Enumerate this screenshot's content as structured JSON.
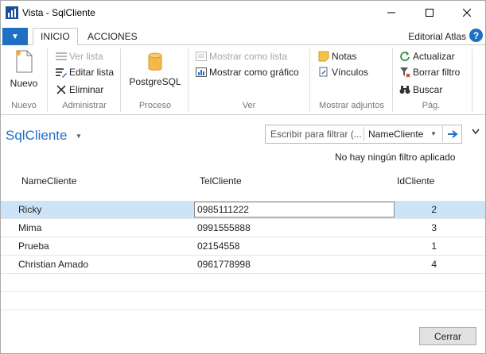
{
  "window": {
    "title": "Vista - SqlCliente"
  },
  "tabs": {
    "inicio": "INICIO",
    "acciones": "ACCIONES"
  },
  "company": "Editorial Atlas",
  "help_label": "?",
  "ribbon": {
    "nuevo": {
      "button": "Nuevo",
      "group": "Nuevo"
    },
    "administrar": {
      "ver_lista": "Ver lista",
      "editar_lista": "Editar lista",
      "eliminar": "Eliminar",
      "group": "Administrar"
    },
    "proceso": {
      "postgresql": "PostgreSQL",
      "group": "Proceso"
    },
    "ver": {
      "mostrar_lista": "Mostrar como lista",
      "mostrar_grafico": "Mostrar como gráfico",
      "group": "Ver"
    },
    "adjuntos": {
      "notas": "Notas",
      "vinculos": "Vínculos",
      "group": "Mostrar adjuntos"
    },
    "pag": {
      "actualizar": "Actualizar",
      "borrar_filtro": "Borrar filtro",
      "buscar": "Buscar",
      "group": "Pág."
    }
  },
  "page": {
    "title": "SqlCliente",
    "filter": {
      "placeholder": "Escribir para filtrar (...",
      "field": "NameCliente"
    },
    "filter_status": "No hay ningún filtro aplicado"
  },
  "table": {
    "columns": [
      "NameCliente",
      "TelCliente",
      "IdCliente"
    ],
    "rows": [
      {
        "name": "Ricky",
        "tel": "0985111222",
        "id": "2"
      },
      {
        "name": "Mima",
        "tel": "0991555888",
        "id": "3"
      },
      {
        "name": "Prueba",
        "tel": "02154558",
        "id": "1"
      },
      {
        "name": "Christian Amado",
        "tel": "0961778998",
        "id": "4"
      }
    ]
  },
  "footer": {
    "close": "Cerrar"
  },
  "colors": {
    "accent": "#1f6fc5",
    "selection": "#cde3f7"
  }
}
